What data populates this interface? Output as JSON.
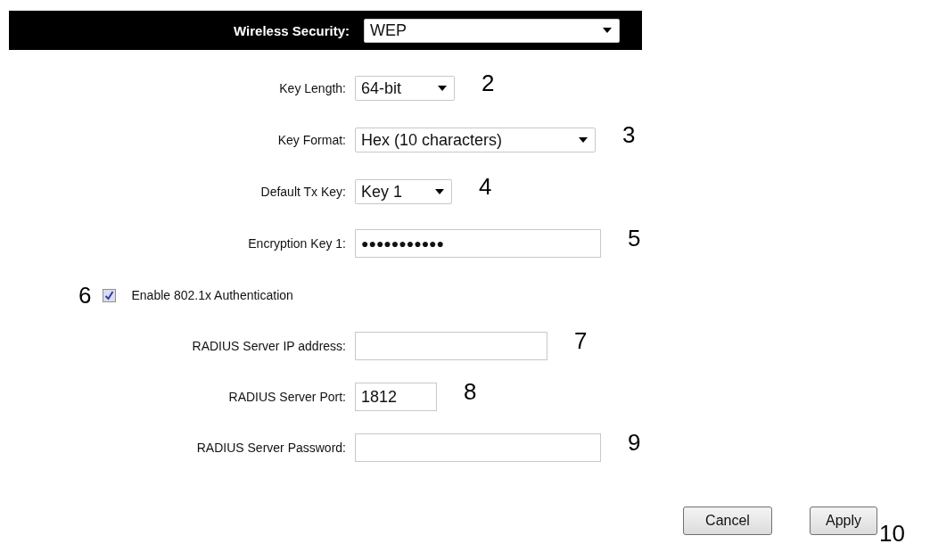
{
  "header": {
    "label": "Wireless Security:",
    "value": "WEP"
  },
  "rows": [
    {
      "kind": "select",
      "label": "Key Length:",
      "value": "64-bit",
      "callout": "2"
    },
    {
      "kind": "select",
      "label": "Key Format:",
      "value": "Hex (10 characters)",
      "callout": "3"
    },
    {
      "kind": "select",
      "label": "Default Tx Key:",
      "value": "Key 1",
      "callout": "4"
    },
    {
      "kind": "password",
      "label": "Encryption Key 1:",
      "value": "●●●●●●●●●●●",
      "callout": "5"
    },
    {
      "kind": "checkbox",
      "label": "Enable 802.1x Authentication",
      "checked": true,
      "callout": "6"
    },
    {
      "kind": "text",
      "label": "RADIUS Server IP address:",
      "callout": "7"
    },
    {
      "kind": "text",
      "label": "RADIUS Server Port:",
      "value": "1812",
      "callout": "8"
    },
    {
      "kind": "text",
      "label": "RADIUS Server Password:",
      "callout": "9"
    }
  ],
  "buttons": [
    {
      "label": "Cancel"
    },
    {
      "label": "Apply"
    }
  ],
  "callout": "10"
}
